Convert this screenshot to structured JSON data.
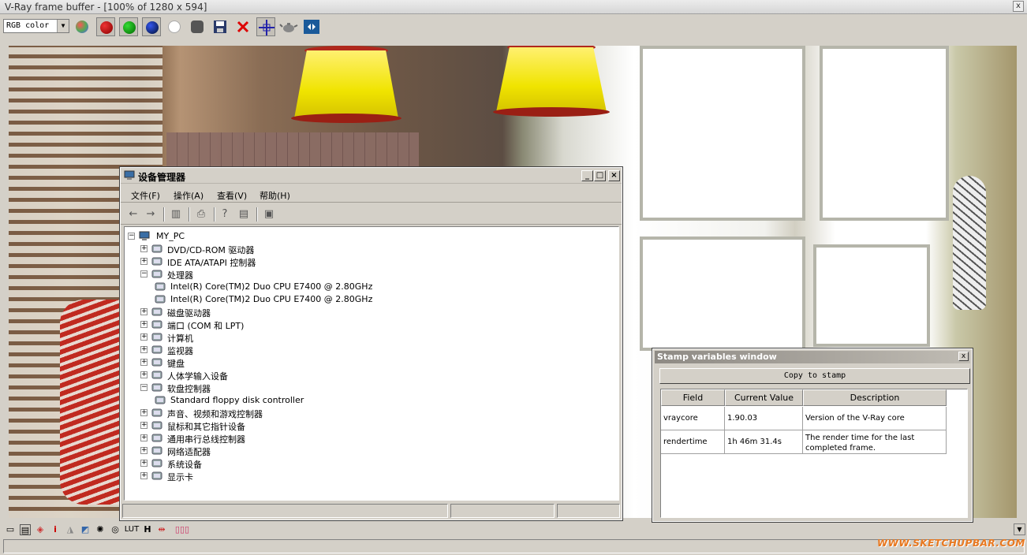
{
  "vfb": {
    "title": "V-Ray frame buffer - [100% of 1280 x 594]",
    "close_glyph": "x",
    "channel": "RGB color",
    "toolbar_icons": [
      "rgb-channels-icon",
      "red-channel-icon",
      "green-channel-icon",
      "blue-channel-icon",
      "alpha-channel-icon",
      "monochrome-icon",
      "save-icon",
      "clear-icon",
      "track-mouse-icon",
      "render-teapot-icon",
      "region-render-icon"
    ],
    "bottom_icons": [
      "show-corrections-icon",
      "stamp-icon",
      "color-picker-icon",
      "info-icon",
      "levels-icon",
      "curve-icon",
      "lens-effects-icon",
      "exposure-icon",
      "lut-icon",
      "history-icon",
      "srgb-icon",
      "pixel-icon"
    ],
    "bottom_labels": {
      "info": "i",
      "lut": "LUT",
      "history": "H"
    },
    "watermark": "WWW.SKETCHUPBAR.COM"
  },
  "device_manager": {
    "title": "设备管理器",
    "menu": [
      "文件(F)",
      "操作(A)",
      "查看(V)",
      "帮助(H)"
    ],
    "root": "MY_PC",
    "tree": [
      {
        "label": "DVD/CD-ROM 驱动器",
        "expanded": false,
        "level": 1,
        "icon": "dvd-drive-icon"
      },
      {
        "label": "IDE ATA/ATAPI 控制器",
        "expanded": false,
        "level": 1,
        "icon": "ide-controller-icon"
      },
      {
        "label": "处理器",
        "expanded": true,
        "level": 1,
        "icon": "processor-icon"
      },
      {
        "label": "Intel(R) Core(TM)2 Duo CPU     E7400  @ 2.80GHz",
        "level": 2,
        "icon": "cpu-icon"
      },
      {
        "label": "Intel(R) Core(TM)2 Duo CPU     E7400  @ 2.80GHz",
        "level": 2,
        "icon": "cpu-icon"
      },
      {
        "label": "磁盘驱动器",
        "expanded": false,
        "level": 1,
        "icon": "disk-drive-icon"
      },
      {
        "label": "端口 (COM 和 LPT)",
        "expanded": false,
        "level": 1,
        "icon": "port-icon"
      },
      {
        "label": "计算机",
        "expanded": false,
        "level": 1,
        "icon": "computer-icon"
      },
      {
        "label": "监视器",
        "expanded": false,
        "level": 1,
        "icon": "monitor-icon"
      },
      {
        "label": "键盘",
        "expanded": false,
        "level": 1,
        "icon": "keyboard-icon"
      },
      {
        "label": "人体学输入设备",
        "expanded": false,
        "level": 1,
        "icon": "hid-icon"
      },
      {
        "label": "软盘控制器",
        "expanded": true,
        "level": 1,
        "icon": "floppy-controller-icon"
      },
      {
        "label": "Standard floppy disk controller",
        "level": 2,
        "icon": "floppy-disabled-icon"
      },
      {
        "label": "声音、视频和游戏控制器",
        "expanded": false,
        "level": 1,
        "icon": "sound-icon"
      },
      {
        "label": "鼠标和其它指针设备",
        "expanded": false,
        "level": 1,
        "icon": "mouse-icon"
      },
      {
        "label": "通用串行总线控制器",
        "expanded": false,
        "level": 1,
        "icon": "usb-icon"
      },
      {
        "label": "网络适配器",
        "expanded": false,
        "level": 1,
        "icon": "network-icon"
      },
      {
        "label": "系统设备",
        "expanded": false,
        "level": 1,
        "icon": "system-icon"
      },
      {
        "label": "显示卡",
        "expanded": false,
        "level": 1,
        "icon": "display-adapter-icon"
      }
    ]
  },
  "stamp_window": {
    "title": "Stamp variables window",
    "close_glyph": "x",
    "copy_button": "Copy to stamp",
    "columns": [
      "Field",
      "Current Value",
      "Description"
    ],
    "rows": [
      {
        "field": "vraycore",
        "value": "1.90.03",
        "description": "Version of the V-Ray core"
      },
      {
        "field": "rendertime",
        "value": "1h 46m 31.4s",
        "description": "The render time for the last completed frame."
      }
    ]
  }
}
